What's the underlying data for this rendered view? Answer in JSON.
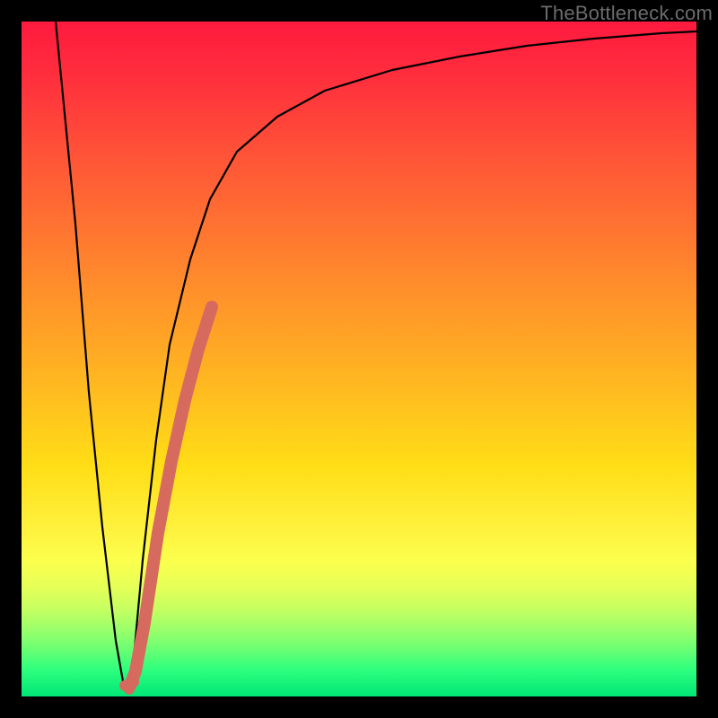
{
  "watermark": "TheBottleneck.com",
  "colors": {
    "frame": "#000000",
    "curve": "#000000",
    "marker": "#d76a5f",
    "gradient_stops": [
      "#ff1a3e",
      "#ff5a36",
      "#ffb621",
      "#fff13d",
      "#2eff7d",
      "#00e676"
    ]
  },
  "chart_data": {
    "type": "line",
    "title": "",
    "xlabel": "",
    "ylabel": "",
    "xlim": [
      0,
      100
    ],
    "ylim": [
      0,
      100
    ],
    "grid": false,
    "legend": false,
    "comment": "No axis tick labels are rendered on the image; values are normalized 0–100. y=0 at bottom.",
    "series": [
      {
        "name": "bottleneck-curve",
        "x": [
          5,
          8,
          10,
          12,
          14,
          15,
          16,
          18,
          20,
          22,
          25,
          28,
          32,
          38,
          45,
          55,
          65,
          75,
          85,
          95,
          100
        ],
        "y": [
          100,
          70,
          45,
          25,
          8,
          2,
          4,
          20,
          38,
          52,
          65,
          74,
          81,
          86,
          90,
          93,
          95,
          96.5,
          97.5,
          98.2,
          98.5
        ]
      }
    ],
    "highlighted_segment": {
      "name": "marker-segment",
      "x": [
        15.5,
        16.5,
        18,
        20,
        22,
        24,
        26,
        28
      ],
      "y": [
        1,
        3,
        8,
        18,
        28,
        37,
        45,
        52
      ]
    }
  }
}
